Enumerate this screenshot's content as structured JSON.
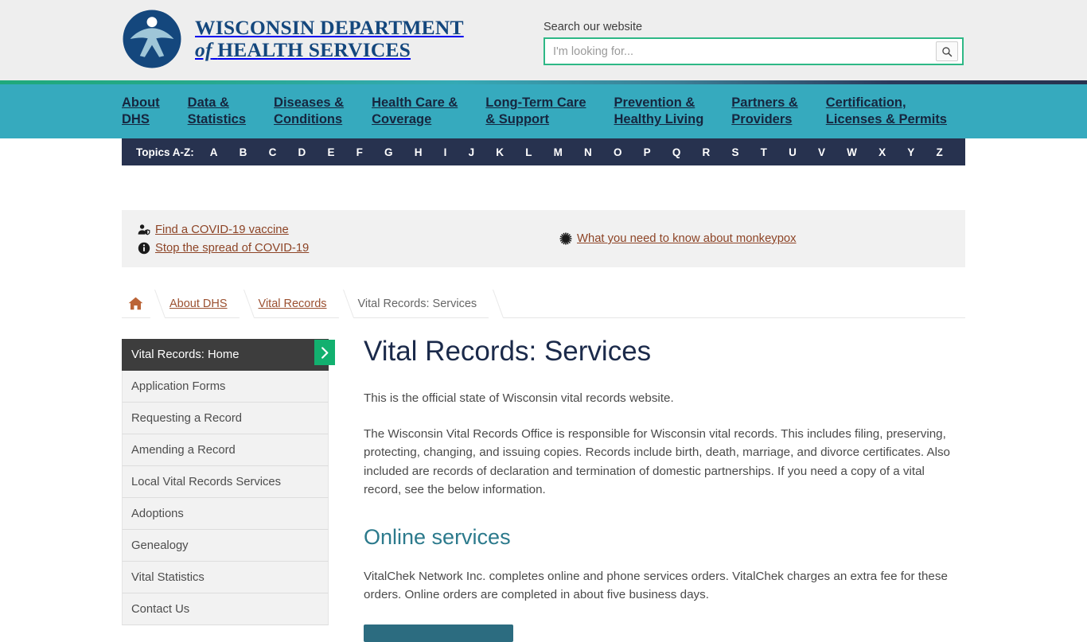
{
  "header": {
    "logo_alt": "dhs-logo",
    "brand_line1": "WISCONSIN DEPARTMENT",
    "brand_of": "of",
    "brand_line2": "HEALTH SERVICES",
    "search": {
      "label": "Search our website",
      "placeholder": "I'm looking for...",
      "value": "",
      "button_icon": "search-icon"
    }
  },
  "mainnav": {
    "items": [
      {
        "label": "About\nDHS"
      },
      {
        "label": "Data &\nStatistics"
      },
      {
        "label": "Diseases &\nConditions"
      },
      {
        "label": "Health Care &\nCoverage"
      },
      {
        "label": "Long-Term Care\n& Support"
      },
      {
        "label": "Prevention &\nHealthy Living"
      },
      {
        "label": "Partners &\nProviders"
      },
      {
        "label": "Certification,\nLicenses & Permits"
      }
    ]
  },
  "topics": {
    "label": "Topics A-Z:",
    "letters": [
      "A",
      "B",
      "C",
      "D",
      "E",
      "F",
      "G",
      "H",
      "I",
      "J",
      "K",
      "L",
      "M",
      "N",
      "O",
      "P",
      "Q",
      "R",
      "S",
      "T",
      "U",
      "V",
      "W",
      "X",
      "Y",
      "Z"
    ]
  },
  "alerts": {
    "left": [
      {
        "icon": "person-shield-icon",
        "label": "Find a COVID-19 vaccine"
      },
      {
        "icon": "info-circle-icon",
        "label": "Stop the spread of COVID-19"
      }
    ],
    "right": [
      {
        "icon": "virus-icon",
        "label": "What you need to know about monkeypox"
      }
    ]
  },
  "breadcrumb": {
    "home_icon": "home-icon",
    "items": [
      {
        "label": "About DHS",
        "current": false
      },
      {
        "label": "Vital Records",
        "current": false
      },
      {
        "label": "Vital Records: Services",
        "current": true
      }
    ]
  },
  "sidebar": {
    "items": [
      {
        "label": "Vital Records: Home",
        "active": true
      },
      {
        "label": "Application Forms",
        "active": false
      },
      {
        "label": "Requesting a Record",
        "active": false
      },
      {
        "label": "Amending a Record",
        "active": false
      },
      {
        "label": "Local Vital Records Services",
        "active": false
      },
      {
        "label": "Adoptions",
        "active": false
      },
      {
        "label": "Genealogy",
        "active": false
      },
      {
        "label": "Vital Statistics",
        "active": false
      },
      {
        "label": "Contact Us",
        "active": false
      }
    ],
    "expand_icon": "chevron-right-icon"
  },
  "main": {
    "title": "Vital Records: Services",
    "intro": "This is the official state of Wisconsin vital records website.",
    "paragraph2": "The Wisconsin Vital Records Office is responsible for Wisconsin vital records. This includes filing, preserving, protecting, changing, and issuing copies. Records include birth, death, marriage, and divorce certificates. Also included are records of declaration and termination of domestic partnerships. If you need a copy of a vital record, see the below information.",
    "section_heading": "Online services",
    "section_paragraph": "VitalChek Network Inc. completes online and phone services orders. VitalChek charges an extra fee for these orders. Online orders are completed in about five business days.",
    "cta_label": ""
  },
  "colors": {
    "brand_navy": "#14477d",
    "nav_teal": "#36aabe",
    "topics_navy": "#27324f",
    "accent_green": "#12b06f",
    "link_rust": "#8d4426",
    "heading_teal": "#2c7a8c",
    "cta_teal": "#2c6c80"
  }
}
